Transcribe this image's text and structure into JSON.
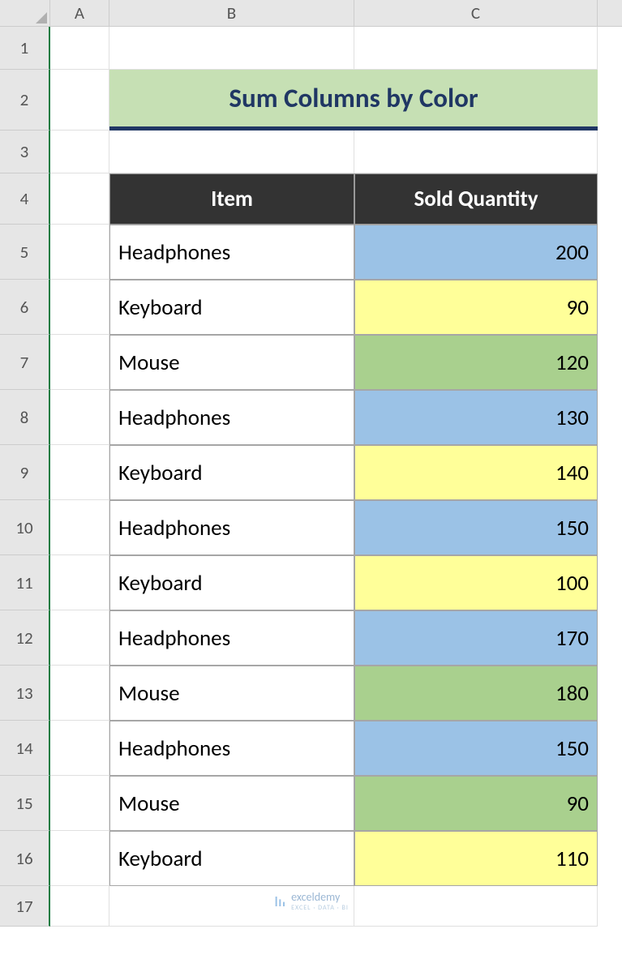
{
  "columns": {
    "A": "A",
    "B": "B",
    "C": "C"
  },
  "rows": [
    "1",
    "2",
    "3",
    "4",
    "5",
    "6",
    "7",
    "8",
    "9",
    "10",
    "11",
    "12",
    "13",
    "14",
    "15",
    "16",
    "17"
  ],
  "title": "Sum Columns by Color",
  "headers": {
    "item": "Item",
    "qty": "Sold Quantity"
  },
  "data": [
    {
      "item": "Headphones",
      "qty": "200",
      "fill": "blue"
    },
    {
      "item": "Keyboard",
      "qty": "90",
      "fill": "yellow"
    },
    {
      "item": "Mouse",
      "qty": "120",
      "fill": "green"
    },
    {
      "item": "Headphones",
      "qty": "130",
      "fill": "blue"
    },
    {
      "item": "Keyboard",
      "qty": "140",
      "fill": "yellow"
    },
    {
      "item": "Headphones",
      "qty": "150",
      "fill": "blue"
    },
    {
      "item": "Keyboard",
      "qty": "100",
      "fill": "yellow"
    },
    {
      "item": "Headphones",
      "qty": "170",
      "fill": "blue"
    },
    {
      "item": "Mouse",
      "qty": "180",
      "fill": "green"
    },
    {
      "item": "Headphones",
      "qty": "150",
      "fill": "blue"
    },
    {
      "item": "Mouse",
      "qty": "90",
      "fill": "green"
    },
    {
      "item": "Keyboard",
      "qty": "110",
      "fill": "yellow"
    }
  ],
  "watermark": {
    "name": "exceldemy",
    "sub": "EXCEL · DATA · BI"
  }
}
